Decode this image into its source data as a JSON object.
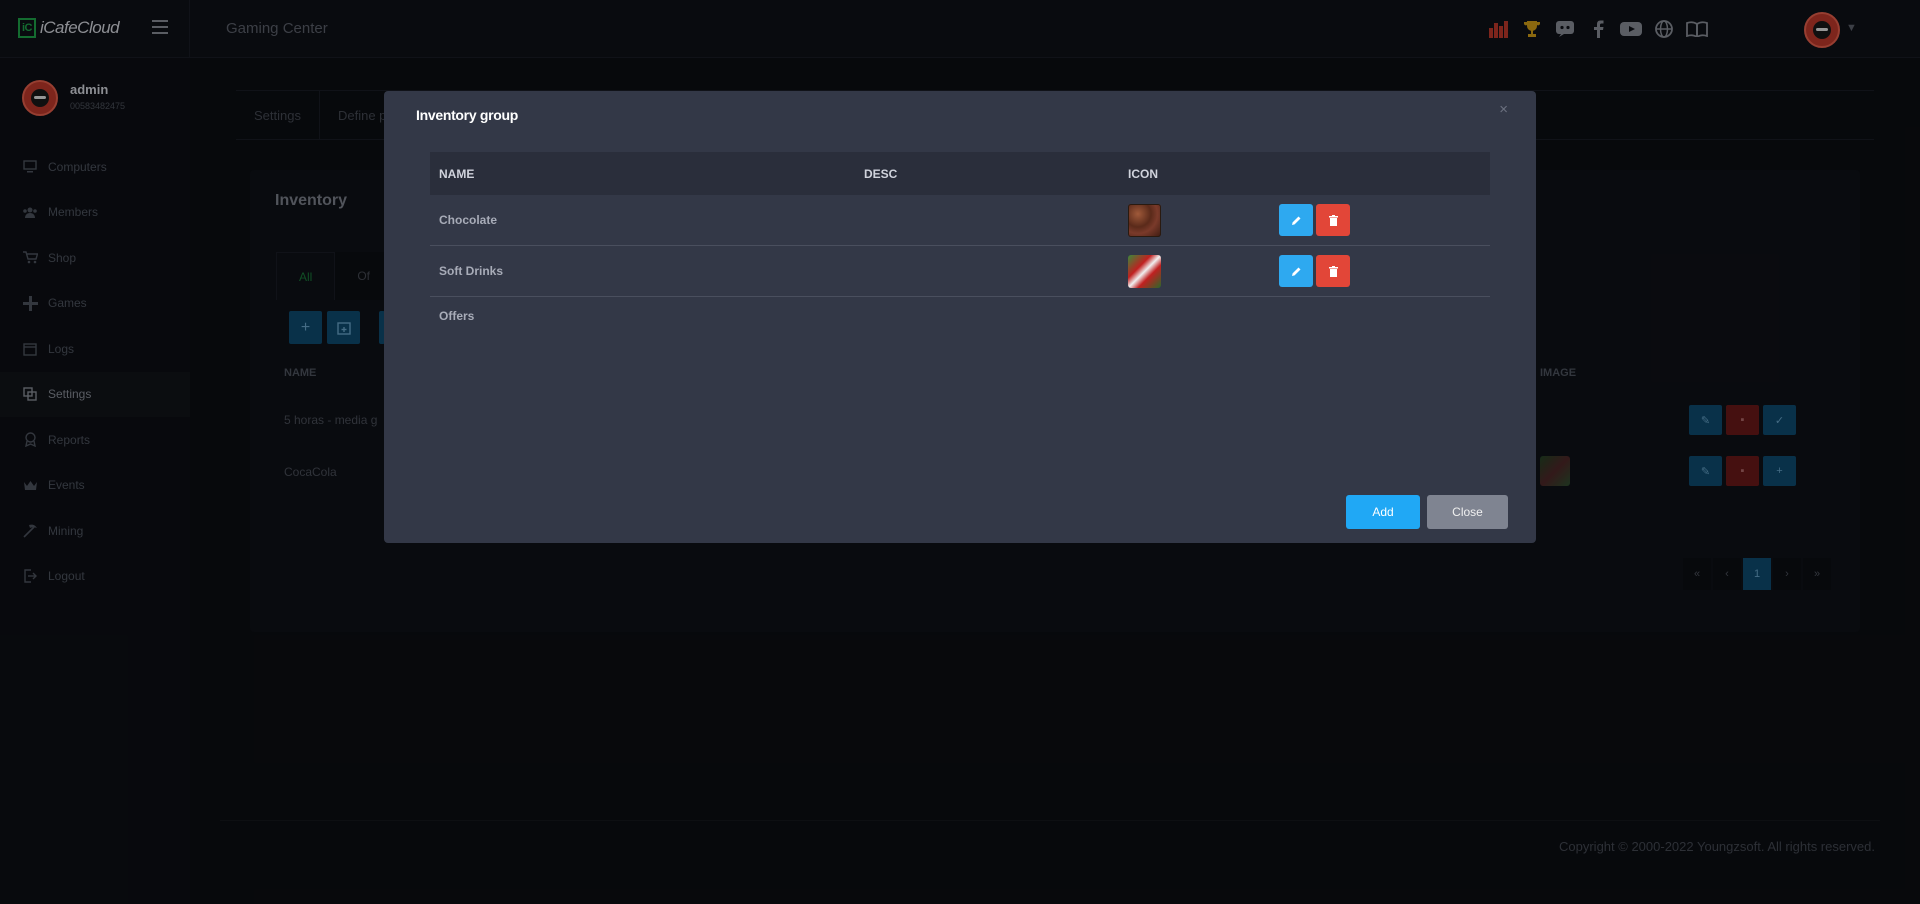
{
  "app": {
    "logo_text": "iCafeCloud",
    "logo_mark": "iC",
    "title": "Gaming Center"
  },
  "topbar": {
    "icons": [
      "stats-bars-icon",
      "trophy-icon",
      "discord-icon",
      "facebook-icon",
      "youtube-icon",
      "globe-icon",
      "book-icon"
    ]
  },
  "user": {
    "name": "admin",
    "id": "00583482475"
  },
  "sidebar": {
    "items": [
      {
        "label": "Computers",
        "icon": "monitor-icon"
      },
      {
        "label": "Members",
        "icon": "users-icon"
      },
      {
        "label": "Shop",
        "icon": "cart-icon"
      },
      {
        "label": "Games",
        "icon": "gamepad-icon"
      },
      {
        "label": "Logs",
        "icon": "calendar-icon"
      },
      {
        "label": "Settings",
        "icon": "settings-icon"
      },
      {
        "label": "Reports",
        "icon": "reports-icon"
      },
      {
        "label": "Events",
        "icon": "crown-icon"
      },
      {
        "label": "Mining",
        "icon": "pickaxe-icon"
      },
      {
        "label": "Logout",
        "icon": "logout-icon"
      }
    ]
  },
  "background": {
    "subnav": [
      "Settings",
      "Define p"
    ],
    "panel_title": "Inventory",
    "tabs": [
      "All",
      "Of"
    ],
    "columns": {
      "name": "NAME",
      "image": "IMAGE"
    },
    "rows": [
      {
        "name": "5 horas - media g"
      },
      {
        "name": "CocaCola"
      }
    ],
    "pager": [
      "«",
      "‹",
      "1",
      "›",
      "»"
    ],
    "footer": "Copyright © 2000-2022 Youngzsoft. All rights reserved."
  },
  "modal": {
    "title": "Inventory group",
    "close_glyph": "×",
    "columns": {
      "name": "NAME",
      "desc": "DESC",
      "icon": "ICON"
    },
    "rows": [
      {
        "name": "Chocolate",
        "desc": "",
        "icon": "chocolate-thumbnail"
      },
      {
        "name": "Soft Drinks",
        "desc": "",
        "icon": "soft-drinks-thumbnail"
      },
      {
        "name": "Offers",
        "desc": "",
        "icon": ""
      }
    ],
    "add_label": "Add",
    "close_label": "Close"
  },
  "colors": {
    "modal_bg": "#333847",
    "edit_button": "#2ea9f0",
    "delete_button": "#e24638",
    "add_button": "#20a8f5",
    "close_button": "#7f8491",
    "brand_green": "#1fa64b"
  }
}
